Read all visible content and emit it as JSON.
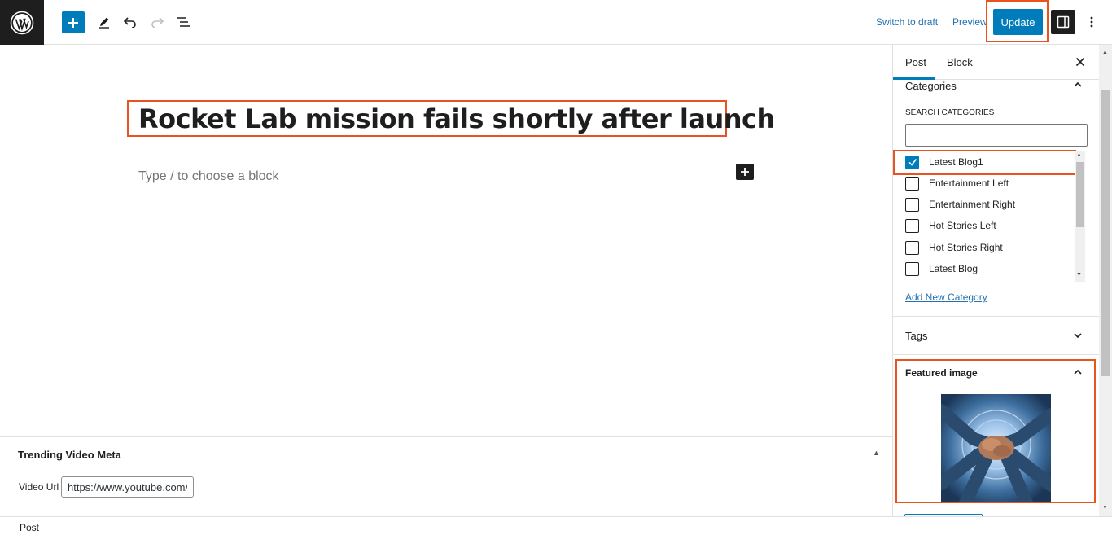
{
  "toolbar": {
    "switch_to_draft": "Switch to draft",
    "preview": "Preview",
    "update": "Update"
  },
  "editor": {
    "title": "Rocket Lab mission fails shortly after launch",
    "placeholder": "Type / to choose a block"
  },
  "meta_box": {
    "title": "Trending Video Meta",
    "video_label": "Video Url",
    "video_value": "https://www.youtube.com/"
  },
  "footer": {
    "breadcrumb": "Post"
  },
  "sidebar": {
    "tabs": [
      {
        "label": "Post",
        "active": true
      },
      {
        "label": "Block",
        "active": false
      }
    ],
    "categories": {
      "title": "Categories",
      "search_label": "Search Categories",
      "items": [
        {
          "label": "Latest Blog1",
          "checked": true
        },
        {
          "label": "Entertainment Left",
          "checked": false
        },
        {
          "label": "Entertainment Right",
          "checked": false
        },
        {
          "label": "Hot Stories Left",
          "checked": false
        },
        {
          "label": "Hot Stories Right",
          "checked": false
        },
        {
          "label": "Latest Blog",
          "checked": false
        }
      ],
      "add_new": "Add New Category"
    },
    "tags": {
      "title": "Tags"
    },
    "featured_image": {
      "title": "Featured image"
    }
  },
  "colors": {
    "accent": "#007cba",
    "highlight": "#e8531f",
    "dark": "#1e1e1e"
  },
  "icons": [
    "wordpress-logo",
    "plus-icon",
    "pen-icon",
    "undo-icon",
    "redo-icon",
    "list-view-icon",
    "settings-panel-icon",
    "more-vertical-icon",
    "close-icon",
    "chevron-up-icon",
    "chevron-down-icon",
    "checkmark-icon"
  ]
}
